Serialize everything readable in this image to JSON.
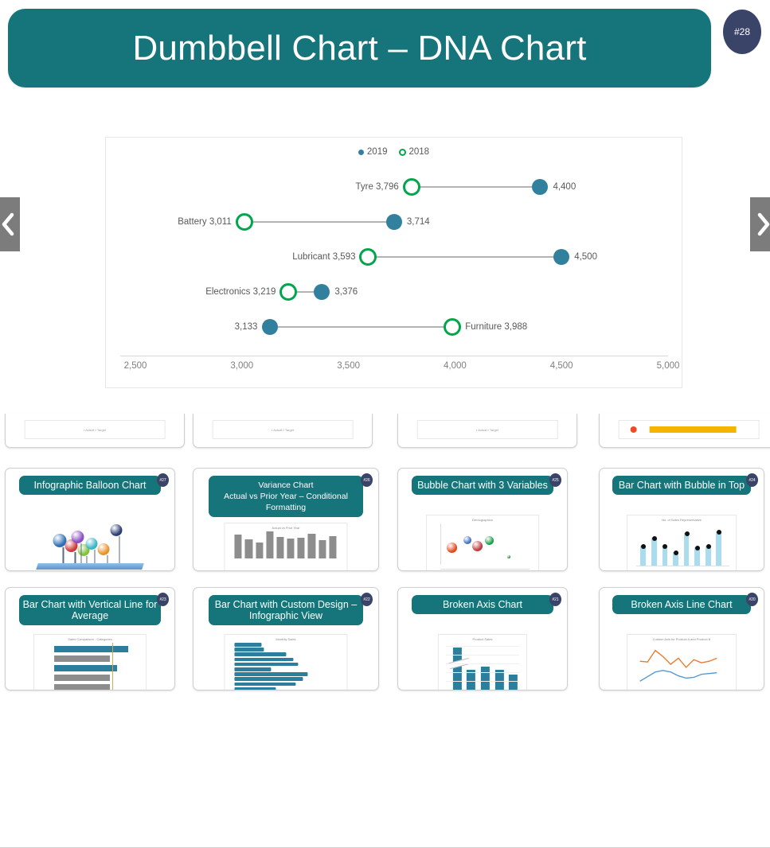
{
  "header": {
    "title": "Dumbbell Chart – DNA Chart",
    "badge": "#28",
    "banner_color": "#15757a",
    "badge_color": "#3a4468"
  },
  "nav": {
    "prev_label": "Previous slide",
    "prev_icon": "chevron-left-icon",
    "next_label": "Next slide",
    "next_icon": "chevron-right-icon"
  },
  "chart_data": {
    "type": "scatter",
    "subtype": "dumbbell",
    "title": "",
    "xlabel": "",
    "ylabel": "",
    "xlim": [
      2500,
      5000
    ],
    "xticks": [
      "2,500",
      "3,000",
      "3,500",
      "4,000",
      "4,500",
      "5,000"
    ],
    "xtick_values": [
      2500,
      3000,
      3500,
      4000,
      4500,
      5000
    ],
    "grid": false,
    "legend_position": "top-center",
    "legend": [
      {
        "name": "2019",
        "marker": "filled-circle",
        "color": "#31809e"
      },
      {
        "name": "2018",
        "marker": "open-circle",
        "color": "#00a64b"
      }
    ],
    "series": [
      {
        "name": "2019",
        "values": [
          4400,
          3714,
          4500,
          3376,
          3133
        ]
      },
      {
        "name": "2018",
        "values": [
          3796,
          3011,
          3593,
          3219,
          3988
        ]
      }
    ],
    "categories": [
      "Tyre",
      "Battery",
      "Lubricant",
      "Electronics",
      "Furniture"
    ],
    "rows": [
      {
        "category": "Tyre",
        "left_label": "Tyre 3,796",
        "right_label": "4,400",
        "v2018": 3796,
        "v2019": 4400,
        "label_side_2018": "left",
        "label_side_2019": "right"
      },
      {
        "category": "Battery",
        "left_label": "Battery 3,011",
        "right_label": "3,714",
        "v2018": 3011,
        "v2019": 3714,
        "label_side_2018": "left",
        "label_side_2019": "right"
      },
      {
        "category": "Lubricant",
        "left_label": "Lubricant 3,593",
        "right_label": "4,500",
        "v2018": 3593,
        "v2019": 4500,
        "label_side_2018": "left",
        "label_side_2019": "right"
      },
      {
        "category": "Electronics",
        "left_label": "Electronics 3,219",
        "right_label": "3,376",
        "v2018": 3219,
        "v2019": 3376,
        "label_side_2018": "left",
        "label_side_2019": "right"
      },
      {
        "category": "Furniture",
        "left_label": "3,133",
        "right_label": "Furniture 3,988",
        "v2018": 3988,
        "v2019": 3133,
        "label_side_2018": "right",
        "label_side_2019": "left"
      }
    ]
  },
  "thumbnails": {
    "partial_row_count": 4,
    "items": [
      {
        "title": "Infographic Balloon Chart",
        "badge": "#27",
        "art": "balloons"
      },
      {
        "title": "Variance Chart\nActual vs Prior Year – Conditional Formatting",
        "badge": "#26",
        "art": "variance"
      },
      {
        "title": "Bubble Chart with 3 Variables",
        "badge": "#25",
        "art": "bubbles"
      },
      {
        "title": "Bar Chart with Bubble in Top",
        "badge": "#24",
        "art": "bar-bubble"
      },
      {
        "title": "Bar Chart with Vertical Line for Average",
        "badge": "#23",
        "art": "hbar-avg"
      },
      {
        "title": "Bar Chart with Custom Design – Infographic View",
        "badge": "#22",
        "art": "hbar-info"
      },
      {
        "title": "Broken Axis Chart",
        "badge": "#21",
        "art": "broken-axis"
      },
      {
        "title": "Broken Axis Line Chart",
        "badge": "#20",
        "art": "broken-line"
      }
    ],
    "mini_titles": {
      "variance": "Actual vs Prior Year",
      "bubbles": "Demographics",
      "bar_bubble": "No. of Sales Representative",
      "hbar_avg": "Sales Comparison - Categories",
      "hbar_info": "Monthly Sales",
      "broken_axis": "Product Sales",
      "broken_line": "Custom Axis for Product A and Product B"
    }
  },
  "colors": {
    "teal_2019": "#31809e",
    "green_2018": "#00a64b",
    "banner": "#15757a",
    "connector": "#b3b3b3",
    "axis": "#d9d9d9"
  }
}
